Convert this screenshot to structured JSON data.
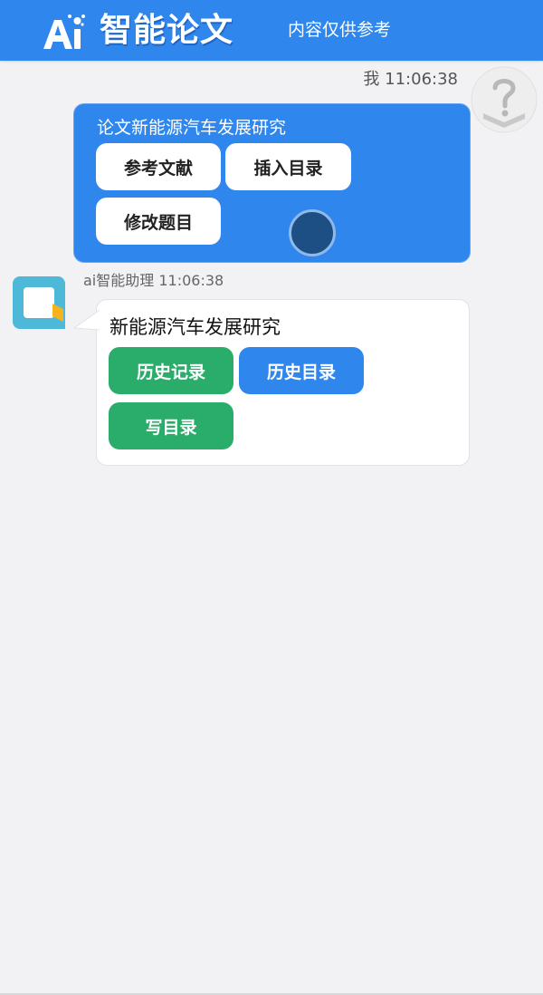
{
  "header": {
    "logo_text": "Ai",
    "brand": "智能论文",
    "disclaimer": "内容仅供参考"
  },
  "colors": {
    "primary": "#2f86ec",
    "green": "#2aac6a",
    "background": "#f2f1f4"
  },
  "user_message": {
    "sender": "我",
    "time": "11:06:38",
    "text": "论文新能源汽车发展研究",
    "buttons": [
      "参考文献",
      "插入目录",
      "修改题目"
    ]
  },
  "assistant_message": {
    "sender": "ai智能助理",
    "time": "11:06:38",
    "text": "新能源汽车发展研究",
    "buttons": [
      "历史记录",
      "历史目录",
      "写目录"
    ]
  },
  "icons": {
    "user_avatar": "question-mark-avatar-icon",
    "assistant_avatar": "assistant-logo-icon",
    "floating_ball": "floating-ball-icon"
  }
}
